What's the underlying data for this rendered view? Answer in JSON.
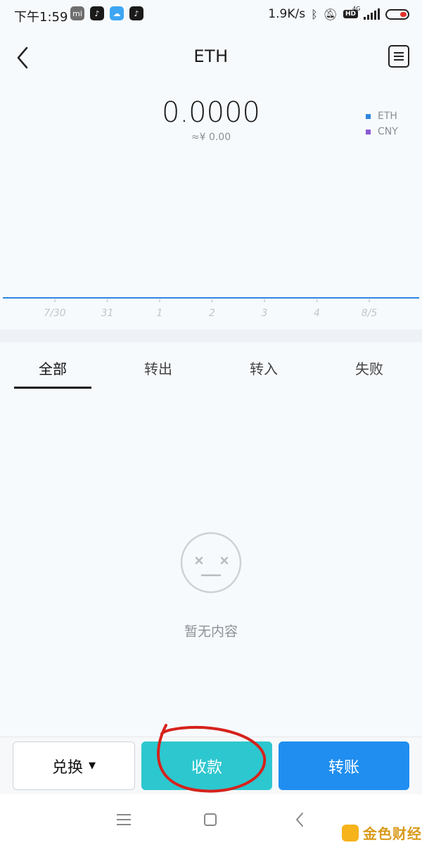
{
  "status_bar": {
    "time": "下午1:59",
    "network_speed": "1.9K/s",
    "network_type": "4G",
    "hd_badge": "HD",
    "app_icons": [
      "mi-app-icon",
      "tiktok-icon",
      "cloud-icon",
      "tiktok-icon"
    ]
  },
  "header": {
    "title": "ETH",
    "back_icon": "chevron-left-icon",
    "records_icon": "document-list-icon"
  },
  "balance": {
    "amount": "0.0000",
    "cny_value": "≈¥ 0.00"
  },
  "legend": [
    {
      "label": "ETH",
      "color": "#2f86df"
    },
    {
      "label": "CNY",
      "color": "#8b5bd6"
    }
  ],
  "chart_data": {
    "type": "line",
    "categories": [
      "7/30",
      "31",
      "1",
      "2",
      "3",
      "4",
      "8/5"
    ],
    "series": [
      {
        "name": "ETH",
        "values": [
          0,
          0,
          0,
          0,
          0,
          0,
          0
        ],
        "color": "#2f86df"
      }
    ],
    "title": "",
    "xlabel": "",
    "ylabel": "",
    "grid": false,
    "legend": "top-right"
  },
  "tabs": [
    {
      "label": "全部",
      "active": true
    },
    {
      "label": "转出",
      "active": false
    },
    {
      "label": "转入",
      "active": false
    },
    {
      "label": "失败",
      "active": false
    }
  ],
  "empty_state": {
    "icon": "neutral-face-icon",
    "text": "暂无内容"
  },
  "actions": {
    "exchange_label": "兑换",
    "receive_label": "收款",
    "transfer_label": "转账"
  },
  "colors": {
    "receive_button": "#2dc7cf",
    "transfer_button": "#1f8ef0",
    "annotation_circle": "#d6221c",
    "background": "#f7fafd"
  },
  "watermark": {
    "text": "金色财经"
  }
}
